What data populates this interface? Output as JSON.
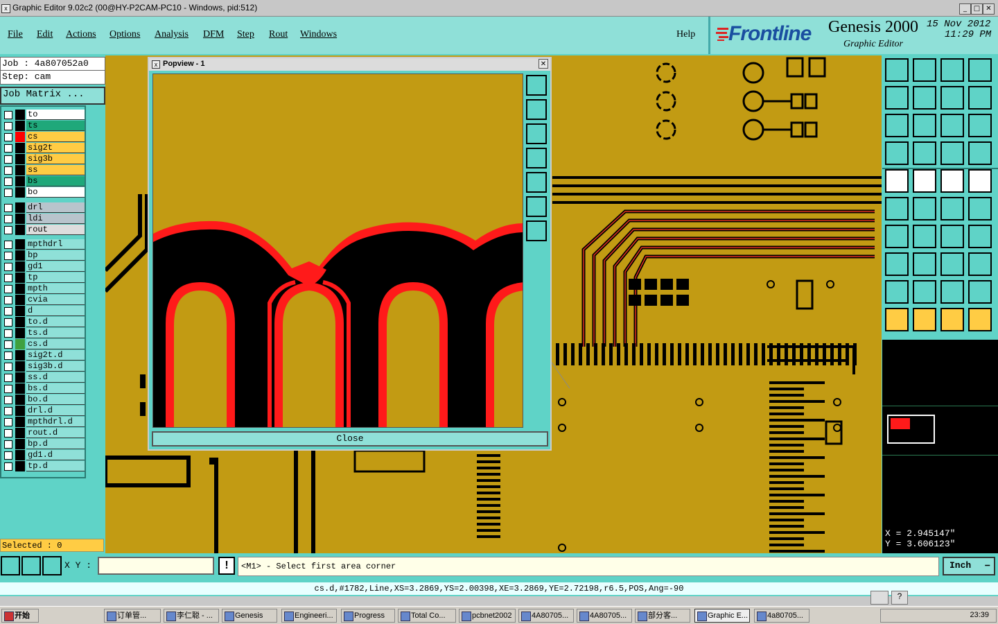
{
  "window": {
    "title": "Graphic Editor 9.02c2 (00@HY-P2CAM-PC10 - Windows, pid:512)",
    "icon": "x-app-icon",
    "min": "_",
    "max": "□",
    "close": "✕"
  },
  "menu": [
    "File",
    "Edit",
    "Actions",
    "Options",
    "Analysis",
    "DFM",
    "Step",
    "Rout",
    "Windows"
  ],
  "help": "Help",
  "brand": {
    "logo": "Frontline",
    "product": "Genesis 2000",
    "subtitle": "Graphic Editor",
    "date": "15 Nov 2012",
    "time": "11:29 PM"
  },
  "left": {
    "job": "Job : 4a807052a0",
    "step": "Step: cam",
    "job_matrix": "Job Matrix ...",
    "selected": "Selected : 0",
    "layers_group1": [
      {
        "name": "to",
        "color": "#ffffff",
        "swatch": "#000000"
      },
      {
        "name": "ts",
        "color": "#1fa87a",
        "swatch": "#000000"
      },
      {
        "name": "cs",
        "color": "#ffcc44",
        "swatch": "#ff0000"
      },
      {
        "name": "sig2t",
        "color": "#ffcc44",
        "swatch": "#000000"
      },
      {
        "name": "sig3b",
        "color": "#ffcc44",
        "swatch": "#000000"
      },
      {
        "name": "ss",
        "color": "#ffcc44",
        "swatch": "#000000"
      },
      {
        "name": "bs",
        "color": "#1fa87a",
        "swatch": "#000000"
      },
      {
        "name": "bo",
        "color": "#ffffff",
        "swatch": "#000000"
      }
    ],
    "layers_group2": [
      {
        "name": "drl",
        "color": "#b8c4cc",
        "swatch": "#000000"
      },
      {
        "name": "ldi",
        "color": "#b8c4cc",
        "swatch": "#000000"
      },
      {
        "name": "rout",
        "color": "#dddddd",
        "swatch": "#000000"
      }
    ],
    "layers_group3": [
      {
        "name": "mpthdrl",
        "color": "#8fe0d8",
        "swatch": "#000000"
      },
      {
        "name": "bp",
        "color": "#8fe0d8",
        "swatch": "#000000"
      },
      {
        "name": "gd1",
        "color": "#8fe0d8",
        "swatch": "#000000"
      },
      {
        "name": "tp",
        "color": "#8fe0d8",
        "swatch": "#000000"
      },
      {
        "name": "mpth",
        "color": "#8fe0d8",
        "swatch": "#000000"
      },
      {
        "name": "cvia",
        "color": "#8fe0d8",
        "swatch": "#000000"
      },
      {
        "name": "d",
        "color": "#8fe0d8",
        "swatch": "#000000"
      },
      {
        "name": "to.d",
        "color": "#8fe0d8",
        "swatch": "#000000"
      },
      {
        "name": "ts.d",
        "color": "#8fe0d8",
        "swatch": "#000000"
      },
      {
        "name": "cs.d",
        "color": "#8fe0d8",
        "swatch": "#3fa03f"
      },
      {
        "name": "sig2t.d",
        "color": "#8fe0d8",
        "swatch": "#000000"
      },
      {
        "name": "sig3b.d",
        "color": "#8fe0d8",
        "swatch": "#000000"
      },
      {
        "name": "ss.d",
        "color": "#8fe0d8",
        "swatch": "#000000"
      },
      {
        "name": "bs.d",
        "color": "#8fe0d8",
        "swatch": "#000000"
      },
      {
        "name": "bo.d",
        "color": "#8fe0d8",
        "swatch": "#000000"
      },
      {
        "name": "drl.d",
        "color": "#8fe0d8",
        "swatch": "#000000"
      },
      {
        "name": "mpthdrl.d",
        "color": "#8fe0d8",
        "swatch": "#000000"
      },
      {
        "name": "rout.d",
        "color": "#8fe0d8",
        "swatch": "#000000"
      },
      {
        "name": "bp.d",
        "color": "#8fe0d8",
        "swatch": "#000000"
      },
      {
        "name": "gd1.d",
        "color": "#8fe0d8",
        "swatch": "#000000"
      },
      {
        "name": "tp.d",
        "color": "#8fe0d8",
        "swatch": "#000000"
      }
    ]
  },
  "popview": {
    "title": "Popview - 1",
    "close_label": "Close",
    "close_x": "✕"
  },
  "coords": {
    "x": "X = 2.945147\"",
    "y": "Y = 3.606123\""
  },
  "cmd": {
    "xy_label": "X Y :",
    "xy_value": "",
    "warn": "!",
    "prompt": "<M1> - Select first area corner",
    "units": "Inch"
  },
  "status": "cs.d,#1782,Line,XS=3.2869,YS=2.00398,XE=3.2869,YE=2.72198,r6.5,POS,Ang=-90",
  "taskbar": {
    "start": "开始",
    "items": [
      "订单管...",
      "李仁聪 - ...",
      "Genesis",
      "Engineeri...",
      "Progress",
      "Total Co...",
      "pcbnet2002",
      "4A80705...",
      "4A80705...",
      "部分客...",
      "Graphic E...",
      "4a80705..."
    ],
    "clock": "23:39"
  }
}
